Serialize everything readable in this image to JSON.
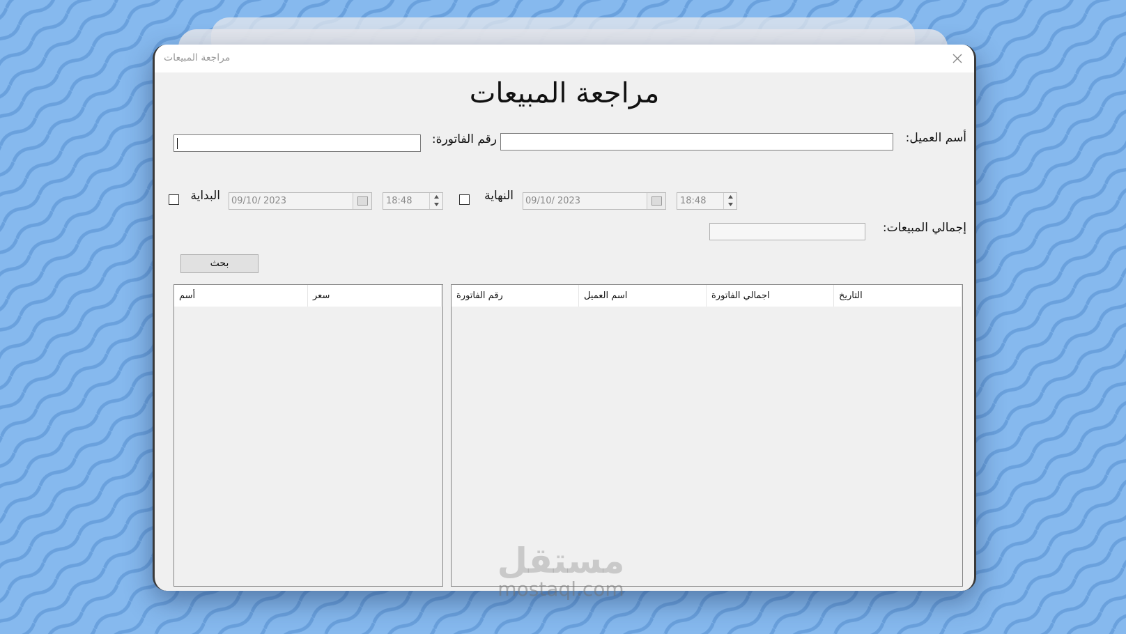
{
  "window": {
    "title": "مراجعة المبيعات",
    "heading": "مراجعة المبيعات"
  },
  "form": {
    "customer_label": "أسم العميل:",
    "customer_value": "",
    "invoice_label": "رقم الفاتورة:",
    "invoice_value": "",
    "start_label": "البداية",
    "start_checked": false,
    "start_date": "09/10/ 2023",
    "start_time": "18:48",
    "end_label": "النهاية",
    "end_checked": false,
    "end_date": "09/10/ 2023",
    "end_time": "18:48",
    "total_label": "إجمالي المبيعات:",
    "total_value": "",
    "search_button": "بحث"
  },
  "items_table": {
    "columns": [
      "أسم",
      "سعر"
    ],
    "rows": []
  },
  "invoices_table": {
    "columns": [
      "رقم الفاتورة",
      "اسم العميل",
      "اجمالي الفاتورة",
      "التاريخ"
    ],
    "rows": []
  },
  "watermark": {
    "logo": "مستقل",
    "text": "mostaql.com"
  },
  "colors": {
    "background": "#7fb3ea",
    "window": "#f0f0f0",
    "titlebar": "#ffffff"
  }
}
